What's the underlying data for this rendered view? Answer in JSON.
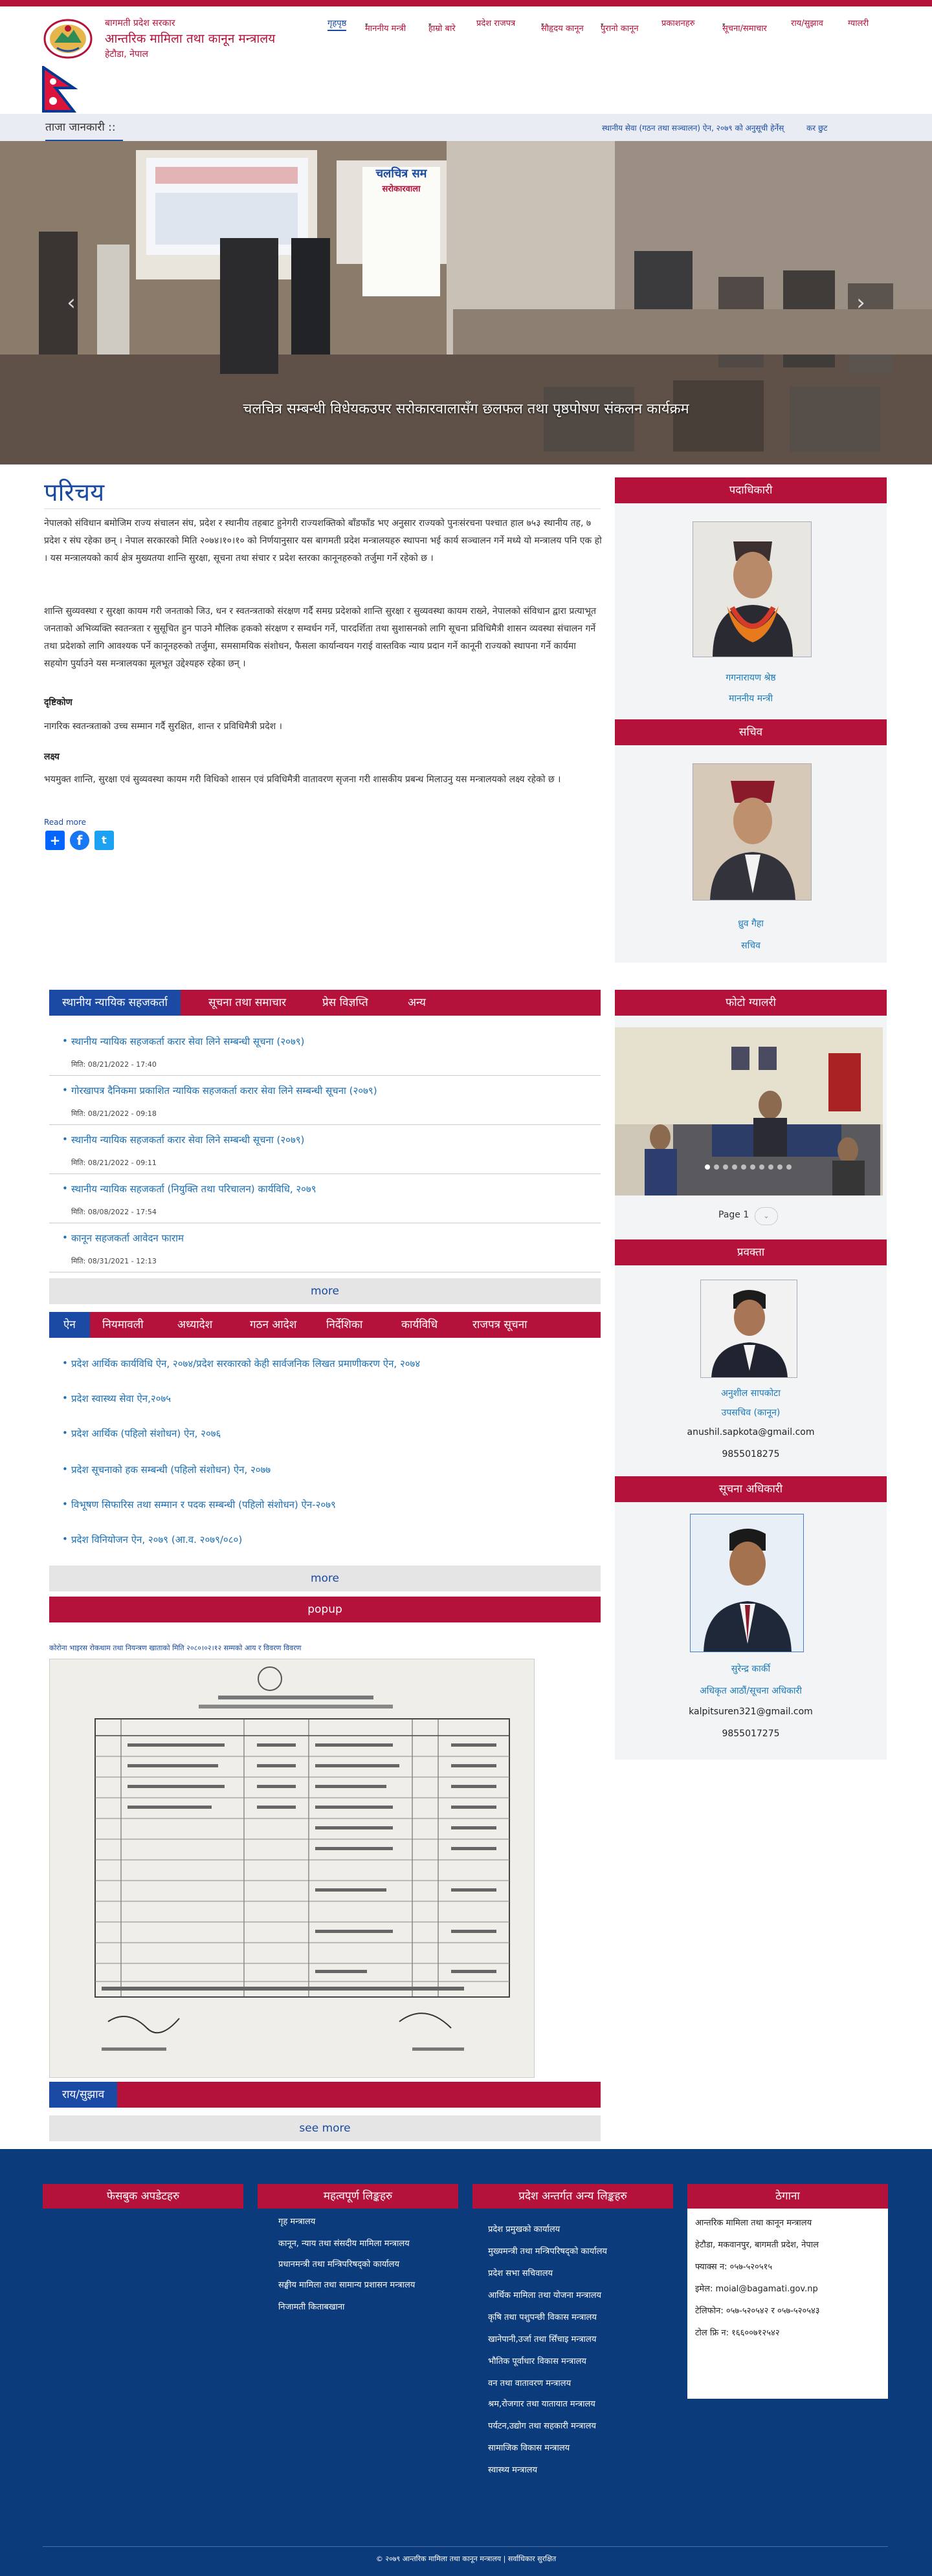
{
  "header": {
    "org_line1": "बागमती प्रदेश सरकार",
    "org_line2": "आन्तरिक मामिला तथा कानून मन्त्रालय",
    "org_line3": "हेटौडा, नेपाल"
  },
  "nav": {
    "items": [
      "गृहपृष्ठ",
      "माननीय मन्त्री",
      "हाम्रो बारे",
      "प्रदेश राजपत्र",
      "सौहृदय कानून",
      "पुरानो कानून",
      "प्रकाशनहरु",
      "सूचना/समाचार",
      "राय/सुझाव",
      "ग्यालरी"
    ]
  },
  "ticker": {
    "label": "ताजा जानकारी ::",
    "items": [
      "स्थानीय सेवा (गठन तथा सञ्चालन) ऐन, २०७९ को अनुसूची हेर्नेस्",
      "कर छुट"
    ]
  },
  "hero": {
    "caption": "चलचित्र सम्बन्धी विधेयकउपर सरोकारवालासँग छलफल तथा पृष्ठपोषण संकलन कार्यक्रम",
    "banner_text1": "चलचित्र सम",
    "banner_text2": "सरोकारवाला"
  },
  "intro": {
    "title": "परिचय",
    "p1": "नेपालको संविधान बमोजिम राज्य संचालन संघ, प्रदेश र स्थानीय तहबाट हुनेगरी राज्यशक्तिको बाँडफाँड भए अनुसार राज्यको पुनःसंरचना पश्चात हाल ७५३ स्थानीय तह, ७ प्रदेश र संघ रहेका छन् । नेपाल सरकारको मिति २०७४।१०।१० को निर्णयानुसार यस बागमती प्रदेश मन्त्रालयहरु स्थापना भई कार्य सञ्चालन गर्ने मध्ये यो मन्त्रालय पनि एक हो । यस मन्त्रालयको कार्य क्षेत्र मुख्यतया शान्ति सुरक्षा, सूचना तथा संचार र प्रदेश स्तरका कानूनहरुको तर्जुमा गर्ने रहेको छ ।",
    "p2": "शान्ति सुव्यवस्था र सुरक्षा कायम गरी जनताको जिउ, धन र स्वतन्त्रताको संरक्षण गर्दै समग्र प्रदेशको शान्ति सुरक्षा र सुव्यवस्था कायम राख्ने, नेपालको संविधान द्वारा प्रत्याभूत जनताको अभिव्यक्ति स्वतन्त्रता र सुसूचित हुन पाउने मौलिक हकको संरक्षण र सम्वर्धन गर्ने, पारदर्शिता तथा सुशासनको लागि सूचना प्रविधिमैत्री शासन व्यवस्था संचालन गर्ने तथा प्रदेशको लागि आवश्यक पर्ने कानूनहरुको तर्जुमा, समसामयिक संशोधन, फैसला कार्यान्वयन गराई वास्तविक न्याय प्रदान गर्ने कानूनी राज्यको स्थापना गर्ने कार्यमा सहयोग पुर्याउने यस मन्त्रालयका मूलभूत उद्देश्यहरु रहेका छन् ।",
    "h_vision": "दृष्टिकोण",
    "vision": "नागरिक स्वतन्त्रताको उच्च सम्मान गर्दै सुरक्षित, शान्त र प्रविधिमैत्री प्रदेश ।",
    "h_goal": "लक्ष्य",
    "goal": "भयमुक्त शान्ति, सुरक्षा एवं सुव्यवस्था कायम गरी विधिको शासन एवं प्रविधिमैत्री वातावरण सृजना गरी शासकीय प्रबन्ध मिलाउनु यस मन्त्रालयको लक्ष्य रहेको छ ।",
    "read_more": "Read more"
  },
  "sidebar": {
    "officials_head": "पदाधिकारी",
    "minister_name": "गगनारायण श्रेष्ठ",
    "minister_title": "माननीय मन्त्री",
    "secretary_head": "सचिव",
    "secretary_name": "ध्रुव गैहा",
    "secretary_title": "सचिव",
    "gallery_head": "फोटो ग्यालरी",
    "page_label": "Page 1",
    "spokesperson_head": "प्रवक्ता",
    "spokesperson_name": "अनुशील सापकोटा",
    "spokesperson_title": "उपसचिव (कानून)",
    "spokesperson_email": "anushil.sapkota@gmail.com",
    "spokesperson_phone": "9855018275",
    "info_officer_head": "सूचना अधिकारी",
    "info_officer_name": "सुरेन्द्र कार्की",
    "info_officer_title": "अधिकृत आठौं/सूचना अधिकारी",
    "info_officer_email": "kalpitsuren321@gmail.com",
    "info_officer_phone": "9855017275"
  },
  "news": {
    "tabs": [
      "स्थानीय न्यायिक सहजकर्ता",
      "सूचना तथा समाचार",
      "प्रेस विज्ञप्ति",
      "अन्य"
    ],
    "items": [
      {
        "title": "स्थानीय न्यायिक सहजकर्ता करार सेवा लिने सम्बन्धी सूचना (२०७९)",
        "date": "मिति: 08/21/2022 - 17:40"
      },
      {
        "title": "गोरखापत्र दैनिकमा प्रकाशित न्यायिक सहजकर्ता करार सेवा लिने सम्बन्धी सूचना (२०७९)",
        "date": "मिति: 08/21/2022 - 09:18"
      },
      {
        "title": "स्थानीय न्यायिक सहजकर्ता करार सेवा लिने सम्बन्धी सूचना (२०७९)",
        "date": "मिति: 08/21/2022 - 09:11"
      },
      {
        "title": "स्थानीय न्यायिक सहजकर्ता (नियुक्ति तथा परिचालन) कार्यविधि, २०७९",
        "date": "मिति: 08/08/2022 - 17:54"
      },
      {
        "title": "कानून सहजकर्ता आवेदन फाराम",
        "date": "मिति: 08/31/2021 - 12:13"
      }
    ],
    "more": "more"
  },
  "laws": {
    "tabs": [
      "ऐन",
      "नियमावली",
      "अध्यादेश",
      "गठन आदेश",
      "निर्देशिका",
      "कार्यविधि",
      "राजपत्र सूचना"
    ],
    "items": [
      "प्रदेश आर्थिक कार्यविधि ऐन, २०७४/प्रदेश सरकारको केही सार्वजनिक लिखत प्रमाणीकरण ऐन, २०७४",
      "प्रदेश स्वास्थ्य सेवा ऐन,२०७५",
      "प्रदेश आर्थिक (पहिलो संशोधन) ऐन, २०७६",
      "प्रदेश सूचनाको हक सम्बन्धी (पहिलो संशोधन) ऐन, २०७७",
      "विभूषण सिफारिस तथा सम्मान र पदक सम्बन्धी (पहिलो संशोधन) ऐन-२०७९",
      "प्रदेश विनियोजन ऐन, २०७९ (आ.व. २०७९/०८०)"
    ],
    "more": "more"
  },
  "popup": {
    "head": "popup",
    "caption": "कोरोना भाइरस रोकथाम तथा नियन्त्रण खाताको मिति २०८०।०२।१२ सम्मको आय र विवरण विवरण"
  },
  "feedback": {
    "tab": "राय/सुझाव",
    "see_more": "see more"
  },
  "footer": {
    "fb_head": "फेसबुक अपडेटहरु",
    "links_head": "महत्वपूर्ण लिङ्कहरु",
    "links": [
      "गृह मन्त्रालय",
      "कानून, न्याय तथा संसदीय मामिला मन्त्रालय",
      "प्रधानमन्त्री तथा मन्त्रिपरिषद्को कार्यालय",
      "सङ्घीय मामिला तथा सामान्य प्रशासन मन्त्रालय",
      "निजामती किताबखाना"
    ],
    "prov_head": "प्रदेश अन्तर्गत अन्य लिङ्कहरु",
    "prov_links": [
      "प्रदेश प्रमुखको कार्यालय",
      "मुख्यमन्त्री तथा मन्त्रिपरिषद्को कार्यालय",
      "प्रदेश सभा सचिवालय",
      "आर्थिक मामिला तथा योजना मन्त्रालय",
      "कृषि तथा पशुपन्छी विकास मन्त्रालय",
      "खानेपानी,उर्जा तथा सिँचाइ मन्त्रालय",
      "भौतिक पूर्वाधार विकास मन्त्रालय",
      "वन तथा वातावरण मन्त्रालय",
      "श्रम,रोजगार तथा यातायात मन्त्रालय",
      "पर्यटन,उद्योग तथा सहकारी मन्त्रालय",
      "सामाजिक विकास मन्त्रालय",
      "स्वास्थ्य मन्त्रालय"
    ],
    "addr_head": "ठेगाना",
    "addr_lines": [
      "आन्तरिक मामिला तथा कानून मन्त्रालय",
      "हेटौडा, मकवानपुर, बागमती प्रदेश, नेपाल",
      "फ्याक्स न: ०५७-५२०५१५",
      "इमेल: moial@bagamati.gov.np",
      "टेलिफोन: ०५७-५२०५४२ र ०५७-५२०५४३",
      "टोल फ्रि न: १६६००७१२५४२"
    ],
    "copyright": "© २०७९ आन्तरिक मामिला तथा कानून मन्त्रालय | सर्वाधिकार सुरक्षित"
  },
  "colors": {
    "brand_red": "#b5123b",
    "brand_blue": "#1a4aa3",
    "footer_blue": "#0c3b7c"
  }
}
